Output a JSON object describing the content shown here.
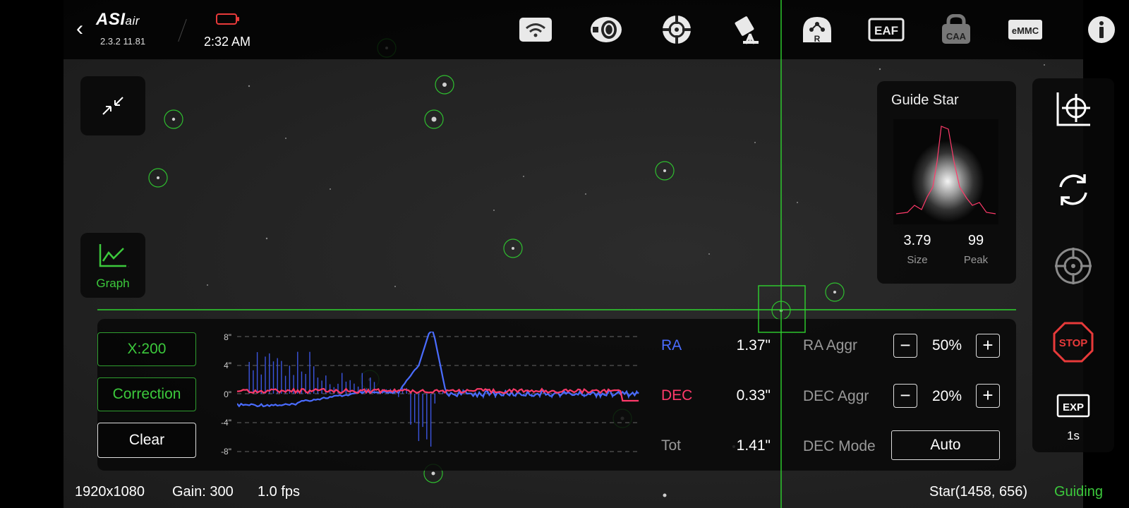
{
  "app": {
    "logo": "ASI",
    "logo_suffix": "air",
    "version": "2.3.2 11.81",
    "time": "2:32 AM"
  },
  "toolbar": {
    "icons": [
      "wifi-icon",
      "mount-icon",
      "guide-target-icon",
      "telescope-icon",
      "r-device-icon",
      "eaf-icon",
      "caa-icon",
      "emmc-icon",
      "info-icon"
    ],
    "eaf_label": "EAF",
    "caa_label": "CAA",
    "emmc_label": "eMMC",
    "r_label": "R"
  },
  "left_buttons": {
    "graph_label": "Graph"
  },
  "guide_star": {
    "title": "Guide Star",
    "size_value": "3.79",
    "size_label": "Size",
    "peak_value": "99",
    "peak_label": "Peak"
  },
  "right_tools": {
    "stop_label": "STOP",
    "exp_badge": "EXP",
    "exp_value": "1s"
  },
  "graph": {
    "x_button": "X:200",
    "mode_button": "Correction",
    "clear_button": "Clear",
    "y_ticks": [
      "8\"",
      "4\"",
      "0\"",
      "-4\"",
      "-8\""
    ]
  },
  "stats": {
    "ra_label": "RA",
    "ra_value": "1.37\"",
    "dec_label": "DEC",
    "dec_value": "0.33\"",
    "tot_label": "Tot",
    "tot_value": "1.41\""
  },
  "controls": {
    "ra_aggr_label": "RA Aggr",
    "ra_aggr_value": "50%",
    "dec_aggr_label": "DEC Aggr",
    "dec_aggr_value": "20%",
    "dec_mode_label": "DEC Mode",
    "dec_mode_value": "Auto"
  },
  "statusbar": {
    "resolution": "1920x1080",
    "gain": "Gain: 300",
    "fps": "1.0 fps",
    "star_position": "Star(1458, 656)",
    "state": "Guiding"
  },
  "colors": {
    "accent_green": "#3cc93c",
    "ra_blue": "#4a6cff",
    "dec_red": "#ff3a6a",
    "stop_red": "#e83a3a"
  }
}
